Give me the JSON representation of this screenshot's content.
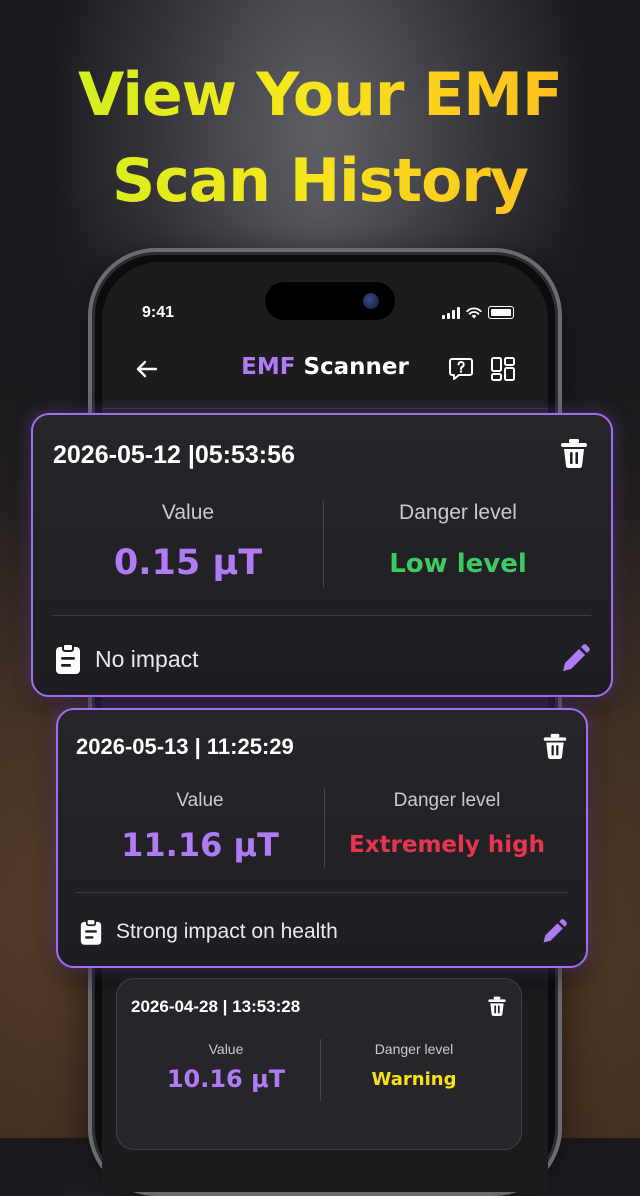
{
  "headline": {
    "line1": "View Your EMF",
    "line2": "Scan History"
  },
  "status_bar": {
    "time": "9:41"
  },
  "app_bar": {
    "title_accent": "EMF",
    "title_rest": "Scanner"
  },
  "records": [
    {
      "datetime": "2026-05-12 |05:53:56",
      "value_label": "Value",
      "value": "0.15 μT",
      "danger_label": "Danger level",
      "danger": "Low level",
      "danger_color": "#3dca62",
      "note": "No impact"
    },
    {
      "datetime": "2026-05-13 | 11:25:29",
      "value_label": "Value",
      "value": "11.16 μT",
      "danger_label": "Danger level",
      "danger": "Extremely high",
      "danger_color": "#e8344e",
      "note": "Strong impact on health"
    },
    {
      "datetime": "2026-04-28 | 13:53:28",
      "value_label": "Value",
      "value": "10.16 μT",
      "danger_label": "Danger level",
      "danger": "Warning",
      "danger_color": "#f6e01a"
    }
  ],
  "colors": {
    "accent": "#a06ef0",
    "value_purple": "#b07cf6"
  },
  "icons": [
    "back-arrow-icon",
    "help-chat-icon",
    "grid-layout-icon",
    "trash-icon",
    "clipboard-icon",
    "pencil-icon"
  ]
}
